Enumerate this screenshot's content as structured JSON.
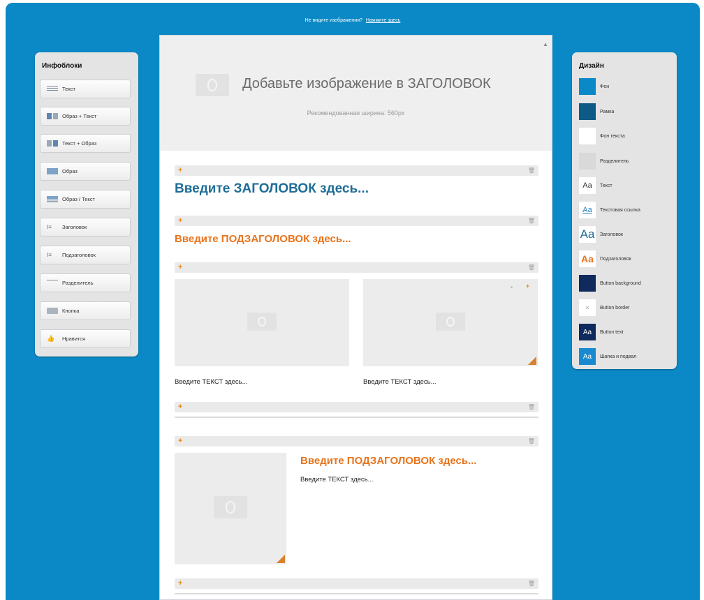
{
  "topbar": {
    "question": "Не видите изображения?",
    "link": "Нажмите здесь"
  },
  "left_panel": {
    "title": "Инфоблоки",
    "items": [
      {
        "label": "Текст",
        "icon": "text-lines-icon"
      },
      {
        "label": "Образ + Текст",
        "icon": "image-text-icon"
      },
      {
        "label": "Текст + Образ",
        "icon": "text-image-icon"
      },
      {
        "label": "Образ",
        "icon": "image-icon"
      },
      {
        "label": "Образ / Текст",
        "icon": "image-over-text-icon"
      },
      {
        "label": "Заголовок",
        "icon": "heading-icon"
      },
      {
        "label": "Подзаголовок",
        "icon": "subheading-icon"
      },
      {
        "label": "Разделитель",
        "icon": "divider-icon"
      },
      {
        "label": "Кнопка",
        "icon": "button-icon"
      },
      {
        "label": "Нравится",
        "icon": "like-icon"
      }
    ]
  },
  "right_panel": {
    "title": "Дизайн",
    "items": [
      {
        "label": "Фон",
        "kind": "swatch",
        "color": "#0a89c6"
      },
      {
        "label": "Рамка",
        "kind": "swatch",
        "color": "#0d5a87"
      },
      {
        "label": "Фон текста",
        "kind": "swatch",
        "color": "#ffffff"
      },
      {
        "label": "Разделитель",
        "kind": "swatch",
        "color": "#d9d9d9"
      },
      {
        "label": "Текст",
        "kind": "aa",
        "glyph": "Aa",
        "color": "#333333"
      },
      {
        "label": "Текстовая ссылка",
        "kind": "aa",
        "glyph": "Aa",
        "color": "#2a7fc0"
      },
      {
        "label": "Заголовок",
        "kind": "aa",
        "glyph": "Aa",
        "color": "#1f6d96"
      },
      {
        "label": "Подзаголовок",
        "kind": "aa",
        "glyph": "Aa",
        "color": "#e8741d"
      },
      {
        "label": "Button background",
        "kind": "swatch",
        "color": "#0f2a5c"
      },
      {
        "label": "Button border",
        "kind": "symbol",
        "glyph": "×",
        "color": "#ffffff"
      },
      {
        "label": "Button text",
        "kind": "aa-dark",
        "glyph": "Aa",
        "color": "#0f2a5c"
      },
      {
        "label": "Шапка и подвал",
        "kind": "aa-blue",
        "glyph": "Aa",
        "color": "#1a8ad0"
      }
    ]
  },
  "canvas": {
    "header_title": "Добавьте изображение в ЗАГОЛОВОК",
    "header_sub": "Рекомендованная ширина: 560px",
    "heading": "Введите ЗАГОЛОВОК здесь...",
    "subheading": "Введите ПОДЗАГОЛОВОК здесь...",
    "col_text_1": "Введите ТЕКСТ здесь...",
    "col_text_2": "Введите ТЕКСТ здесь...",
    "side_subheading": "Введите ПОДЗАГОЛОВОК здесь...",
    "side_text": "Введите ТЕКСТ здесь...",
    "image_controls": {
      "minus": "-",
      "plus": "+"
    }
  },
  "colors": {
    "accent": "#e8741d",
    "heading": "#1f6d96",
    "background": "#0a89c6"
  }
}
